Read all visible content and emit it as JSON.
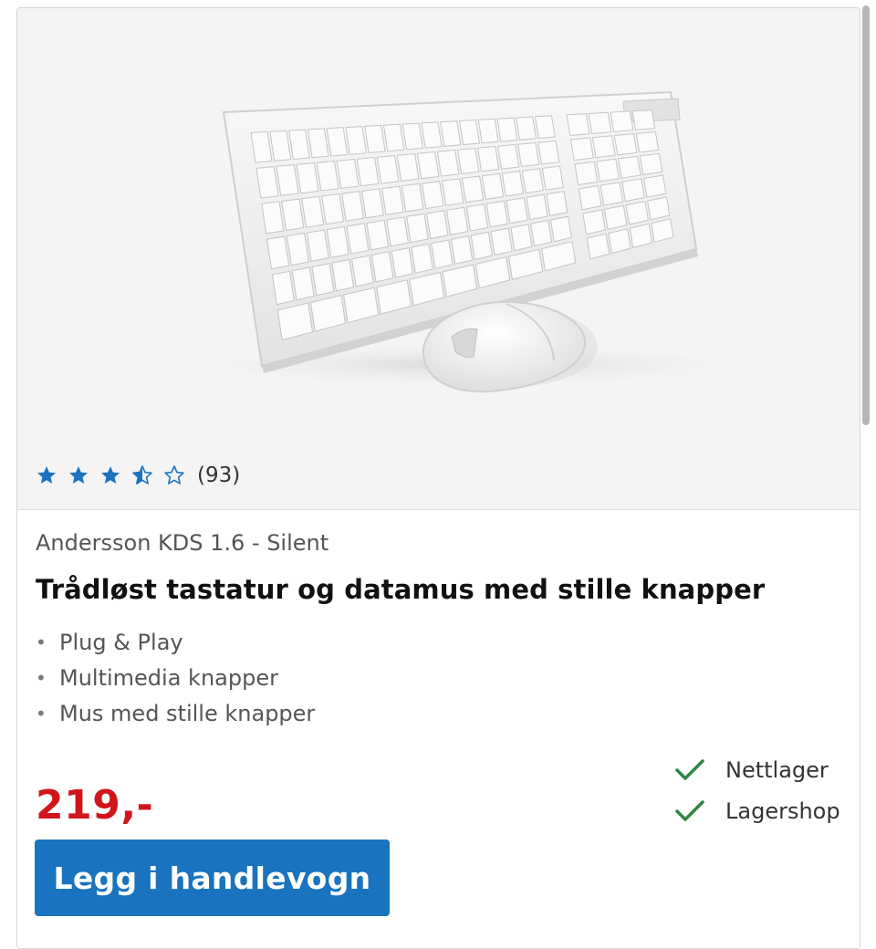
{
  "product": {
    "image_alt": "Trådløst tastatur og datamus",
    "rating": {
      "value": 3.5,
      "max": 5,
      "count_label": "(93)",
      "star_color": "#1a73be"
    },
    "brand_model": "Andersson KDS 1.6 - Silent",
    "title": "Trådløst tastatur og datamus med stille knapper",
    "features": [
      "Plug & Play",
      "Multimedia knapper",
      "Mus med stille knapper"
    ],
    "price": "219,-",
    "price_color": "#d0161a",
    "availability": [
      {
        "label": "Nettlager",
        "icon": "check-icon",
        "color": "#2e8540"
      },
      {
        "label": "Lagershop",
        "icon": "check-icon",
        "color": "#2e8540"
      }
    ],
    "add_to_cart_label": "Legg i handlevogn",
    "button_color": "#1a73be"
  }
}
